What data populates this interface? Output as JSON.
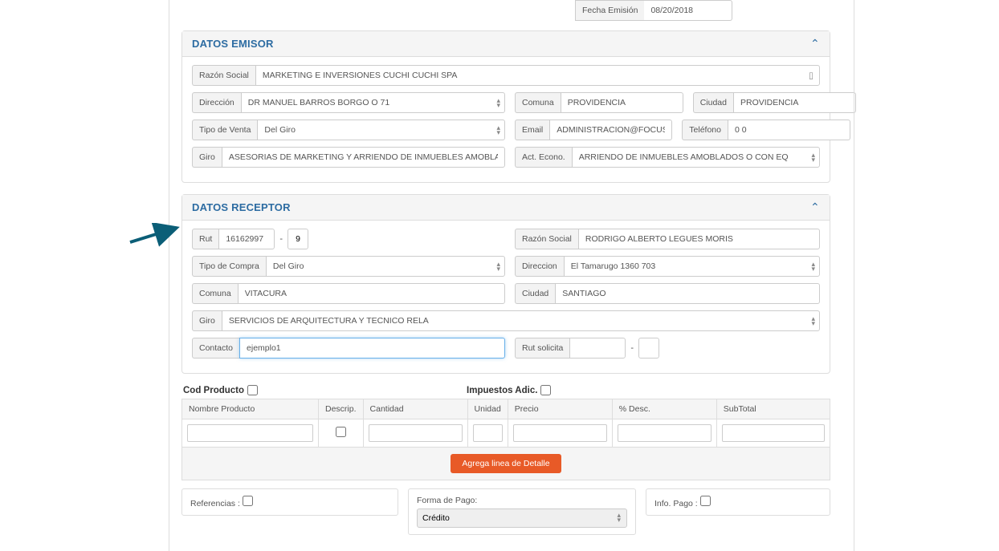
{
  "document": {
    "fechaEmision": {
      "label": "Fecha Emisión",
      "value": "08/20/2018"
    }
  },
  "emisor": {
    "title": "DATOS EMISOR",
    "razonSocial": {
      "label": "Razón Social",
      "value": "MARKETING E INVERSIONES CUCHI CUCHI SPA"
    },
    "direccion": {
      "label": "Dirección",
      "value": "DR MANUEL BARROS BORGO O 71"
    },
    "comuna": {
      "label": "Comuna",
      "value": "PROVIDENCIA"
    },
    "ciudad": {
      "label": "Ciudad",
      "value": "PROVIDENCIA"
    },
    "tipoVenta": {
      "label": "Tipo de Venta",
      "value": "Del Giro"
    },
    "email": {
      "label": "Email",
      "value": "ADMINISTRACION@FOCUSW"
    },
    "telefono": {
      "label": "Teléfono",
      "value": "0 0"
    },
    "giro": {
      "label": "Giro",
      "value": "ASESORIAS DE MARKETING Y ARRIENDO DE INMUEBLES AMOBLADOS"
    },
    "actEcono": {
      "label": "Act. Econo.",
      "value": "ARRIENDO DE INMUEBLES AMOBLADOS O CON EQ"
    }
  },
  "receptor": {
    "title": "DATOS RECEPTOR",
    "rut": {
      "label": "Rut",
      "value": "16162997",
      "dv": "9"
    },
    "razonSocial": {
      "label": "Razón Social",
      "value": "RODRIGO ALBERTO LEGUES MORIS"
    },
    "tipoCompra": {
      "label": "Tipo de Compra",
      "value": "Del Giro"
    },
    "direccion": {
      "label": "Direccion",
      "value": "El Tamarugo 1360 703"
    },
    "comuna": {
      "label": "Comuna",
      "value": "VITACURA"
    },
    "ciudad": {
      "label": "Ciudad",
      "value": "SANTIAGO"
    },
    "giro": {
      "label": "Giro",
      "value": "SERVICIOS DE ARQUITECTURA Y TECNICO RELA"
    },
    "contacto": {
      "label": "Contacto",
      "value": "ejemplo1"
    },
    "rutSolicita": {
      "label": "Rut solicita",
      "value": "",
      "dv": ""
    }
  },
  "detalle": {
    "codProducto": "Cod Producto",
    "impuestosAdic": "Impuestos Adic.",
    "headers": {
      "nombre": "Nombre Producto",
      "descrip": "Descrip.",
      "cantidad": "Cantidad",
      "unidad": "Unidad",
      "precio": "Precio",
      "pdesc": "% Desc.",
      "subtotal": "SubTotal"
    },
    "addLine": "Agrega linea de Detalle"
  },
  "footer": {
    "referencias": "Referencias :",
    "formaPago": {
      "label": "Forma de Pago:",
      "value": "Crédito"
    },
    "infoPago": "Info. Pago :"
  }
}
